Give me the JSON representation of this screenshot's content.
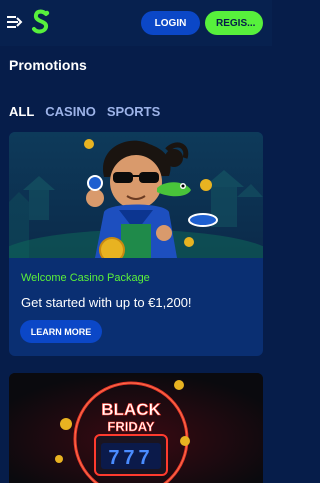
{
  "header": {
    "menu_icon": "menu-arrow-icon",
    "logo_icon": "brand-s-logo-icon",
    "login_label": "LOGIN",
    "register_label": "REGIS..."
  },
  "page": {
    "title": "Promotions"
  },
  "tabs": [
    {
      "label": "ALL",
      "active": true
    },
    {
      "label": "CASINO",
      "active": false
    },
    {
      "label": "SPORTS",
      "active": false
    }
  ],
  "promotions": [
    {
      "subtitle": "Welcome Casino Package",
      "title": "Get started with up to €1,200!",
      "button_label": "LEARN MORE"
    },
    {
      "banner_line1": "BLACK",
      "banner_line2": "FRIDAY",
      "reels": "777"
    }
  ],
  "colors": {
    "background": "#061d4a",
    "card": "#0a2f72",
    "button_blue": "#0b47c7",
    "accent_green": "#57f03c"
  }
}
